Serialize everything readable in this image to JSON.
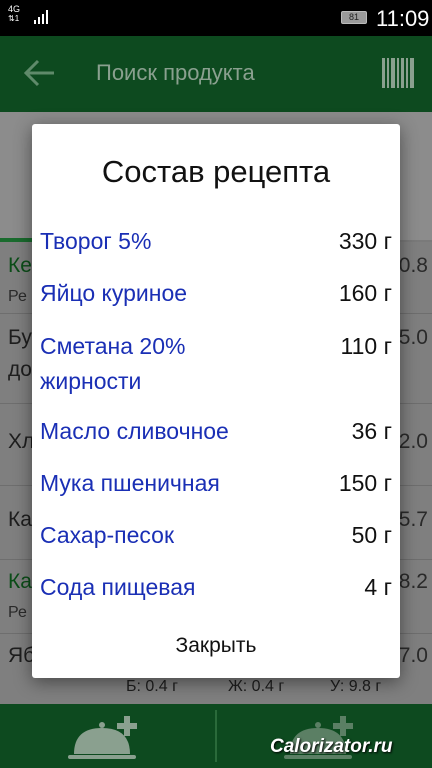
{
  "status_bar": {
    "network": "4G",
    "battery": "81",
    "time": "11:09"
  },
  "app_bar": {
    "title": "Поиск продукта",
    "back_icon": "arrow-left-icon",
    "barcode_icon": "barcode-icon"
  },
  "background_list": {
    "rows": [
      {
        "title": "Ке",
        "subtitle": "Ре",
        "value": "0.8"
      },
      {
        "title": "Бу",
        "subtitle": "до",
        "value": "5.0"
      },
      {
        "title": "Хл",
        "subtitle": "",
        "value": "2.0"
      },
      {
        "title": "Ка",
        "subtitle": "",
        "value": "5.7"
      },
      {
        "title": "Ка",
        "subtitle": "Ре",
        "value": "8.2"
      },
      {
        "title": "Яб",
        "subtitle": "",
        "value": "7.0"
      }
    ],
    "macros": {
      "protein": "Б: 0.4 г",
      "fat": "Ж: 0.4 г",
      "carbs": "У: 9.8 г"
    }
  },
  "dialog": {
    "title": "Состав рецепта",
    "ingredients": [
      {
        "name": "Творог 5%",
        "qty": "330 г"
      },
      {
        "name": "Яйцо куриное",
        "qty": "160 г"
      },
      {
        "name": "Сметана 20% жирности",
        "qty": "110 г"
      },
      {
        "name": "Масло сливочное",
        "qty": "36 г"
      },
      {
        "name": "Мука пшеничная",
        "qty": "150 г"
      },
      {
        "name": "Сахар-песок",
        "qty": "50 г"
      },
      {
        "name": "Сода пищевая",
        "qty": "4 г"
      }
    ],
    "close_label": "Закрыть"
  },
  "bottom_bar": {
    "left_icon": "dish-add-icon",
    "right_icon": "dish-add-icon"
  },
  "watermark": "Calorizator.ru",
  "colors": {
    "primary_green": "#1a6b2e",
    "ingredient_blue": "#1a2fb5"
  }
}
